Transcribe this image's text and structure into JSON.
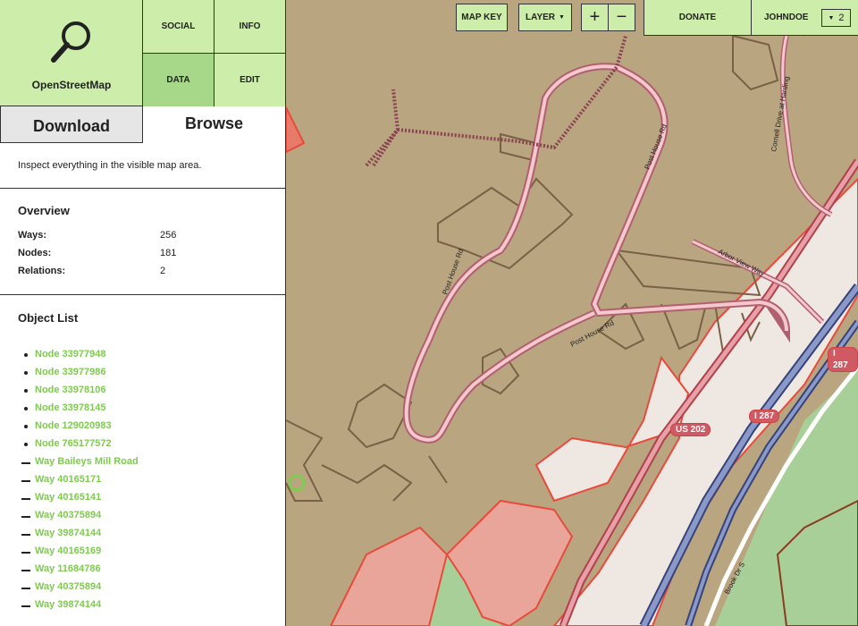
{
  "logo": {
    "label": "OpenStreetMap"
  },
  "nav": {
    "social": "SOCIAL",
    "info": "INFO",
    "data": "DATA",
    "edit": "EDIT"
  },
  "tabs": {
    "download": "Download",
    "browse": "Browse"
  },
  "description": "Inspect everything in the visible map area.",
  "overview": {
    "title": "Overview",
    "ways_label": "Ways:",
    "ways_value": "256",
    "nodes_label": "Nodes:",
    "nodes_value": "181",
    "relations_label": "Relations:",
    "relations_value": "2"
  },
  "object_list": {
    "title": "Object List",
    "items": [
      {
        "type": "node",
        "label": "Node 33977948"
      },
      {
        "type": "node",
        "label": "Node 33977986"
      },
      {
        "type": "node",
        "label": "Node 33978106"
      },
      {
        "type": "node",
        "label": "Node 33978145"
      },
      {
        "type": "node",
        "label": "Node 129020983"
      },
      {
        "type": "node",
        "label": "Node 765177572"
      },
      {
        "type": "way",
        "label": "Way Baileys Mill Road"
      },
      {
        "type": "way",
        "label": "Way 40165171"
      },
      {
        "type": "way",
        "label": "Way 40165141"
      },
      {
        "type": "way",
        "label": "Way 40375894"
      },
      {
        "type": "way",
        "label": "Way 39874144"
      },
      {
        "type": "way",
        "label": "Way 40165169"
      },
      {
        "type": "way",
        "label": "Way 11684786"
      },
      {
        "type": "way",
        "label": "Way 40375894"
      },
      {
        "type": "way",
        "label": "Way 39874144"
      }
    ]
  },
  "map_controls": {
    "map_key": "MAP KEY",
    "layer": "LAYER",
    "zoom_in": "+",
    "zoom_out": "−"
  },
  "account": {
    "donate": "DONATE",
    "username": "JOHNDOE",
    "notifications": "2"
  },
  "map_labels": {
    "post_house_rd": "Post House Rd",
    "arbor_view_way": "Arbor View Way",
    "cornell_drive": "Cornell Drive at Harding",
    "brook_dr": "Brook Dr S",
    "us202": "US 202",
    "i287": "I 287"
  },
  "colors": {
    "accent": "#cdeeaa",
    "accent_active": "#a7d88a",
    "link": "#7ecb4e",
    "map_bg": "#b9a681"
  }
}
